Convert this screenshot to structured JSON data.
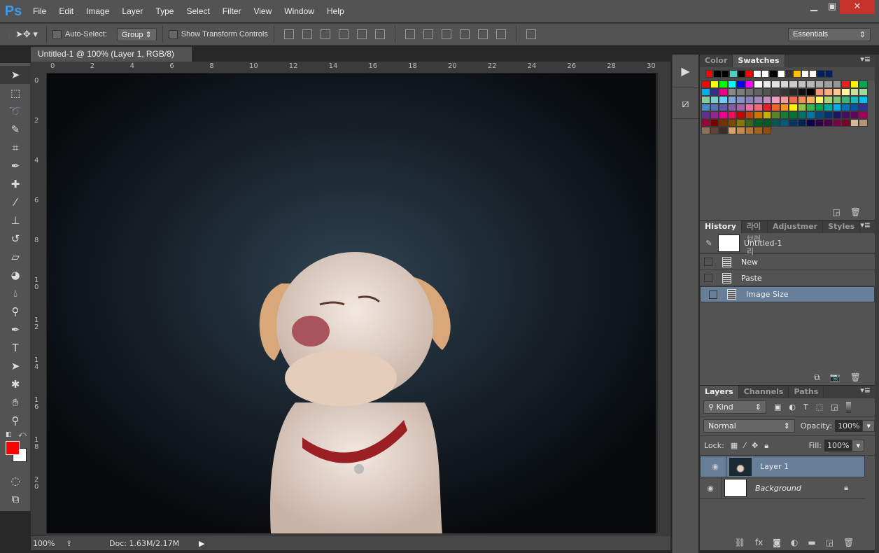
{
  "app": {
    "logo": "Ps",
    "menu": [
      "File",
      "Edit",
      "Image",
      "Layer",
      "Type",
      "Select",
      "Filter",
      "View",
      "Window",
      "Help"
    ],
    "window_controls": [
      "minimize",
      "restore",
      "close"
    ]
  },
  "options": {
    "auto_select_label": "Auto-Select:",
    "auto_select_checked": false,
    "group_value": "Group",
    "show_transform_label": "Show Transform Controls",
    "show_transform_checked": false,
    "workspace": "Essentials"
  },
  "document": {
    "tab_title": "Untitled-1 @ 100% (Layer 1, RGB/8) *",
    "close": "×"
  },
  "rulers": {
    "top": [
      "0",
      "2",
      "4",
      "6",
      "8",
      "10",
      "12",
      "14",
      "16",
      "18",
      "20",
      "22",
      "24",
      "26",
      "28",
      "30"
    ],
    "left": [
      "0",
      "2",
      "4",
      "6",
      "8",
      "10",
      "12",
      "14",
      "16",
      "18",
      "20"
    ]
  },
  "tools": [
    "move-tool",
    "marquee-tool",
    "lasso-tool",
    "quick-selection-tool",
    "crop-tool",
    "eyedropper-tool",
    "healing-brush-tool",
    "brush-tool",
    "clone-stamp-tool",
    "history-brush-tool",
    "eraser-tool",
    "paint-bucket-tool",
    "blur-tool",
    "dodge-tool",
    "pen-tool",
    "type-tool",
    "path-selection-tool",
    "shape-tool",
    "hand-tool",
    "zoom-tool"
  ],
  "colors": {
    "foreground": "#ff0000",
    "background": "#ffffff",
    "selection": "#677f99",
    "canvas_bg": "#1c2a33"
  },
  "status": {
    "zoom": "100%",
    "doc": "Doc: 1.63M/2.17M"
  },
  "swatches": {
    "tabs": [
      "Color",
      "Swatches"
    ],
    "active": "Swatches",
    "recent": [
      "#ff0000",
      "#000000",
      "#000000",
      "#4ecdc4",
      "#000000",
      "#ff0000",
      "#ffffff",
      "#ffffff",
      "#000000",
      "#ffffff",
      "#333333",
      "#ffc000",
      "#fff5f5",
      "#fff8f0",
      "#002060",
      "#002060"
    ],
    "grid": [
      [
        "#ff0000",
        "#ffff00",
        "#00ff00",
        "#00ffff",
        "#0000ff",
        "#ff00ff",
        "#ffffff",
        "#ebebeb",
        "#e1e1e1",
        "#d7d7d7",
        "#cccccc",
        "#c2c2c2",
        "#b7b7b7",
        "#acacac",
        "#a0a0a0",
        "#959595",
        "#ee1d24",
        "#fff100",
        "#00a650"
      ],
      [
        "#00aeef",
        "#2f3192",
        "#ed008c",
        "#898989",
        "#7d7d7d",
        "#707070",
        "#626262",
        "#555555",
        "#464646",
        "#363636",
        "#262626",
        "#111111",
        "#000000",
        "#f7977a",
        "#fbad82",
        "#fdc68c",
        "#fff799",
        "#c6df9c",
        "#a4d49d"
      ],
      [
        "#81ca9d",
        "#7bcdc9",
        "#6ccff7",
        "#7ea6e0",
        "#8493ca",
        "#8882be",
        "#a287bd",
        "#c78dc0",
        "#f49ac1",
        "#f5989d",
        "#f16c4d",
        "#f68e54",
        "#fbaf5a",
        "#fff467",
        "#acd372",
        "#7dc473",
        "#39b778",
        "#16bcb4",
        "#00bff3"
      ],
      [
        "#438ccb",
        "#5573b7",
        "#5e5ca7",
        "#855fa8",
        "#a763a9",
        "#ef6ea8",
        "#f16d7e",
        "#ee1d24",
        "#f16522",
        "#f7941d",
        "#fff100",
        "#8fc63d",
        "#37b44a",
        "#00a650",
        "#00a99e",
        "#00aeef",
        "#0072bc",
        "#0054a5",
        "#2f3192"
      ],
      [
        "#652c91",
        "#91278f",
        "#ed008c",
        "#ee105a",
        "#c80000",
        "#c1440e",
        "#c87800",
        "#c4b000",
        "#598527",
        "#197b30",
        "#007236",
        "#00746b",
        "#0076a4",
        "#004a80",
        "#003370",
        "#1d1363",
        "#450e61",
        "#62055f",
        "#9e005c"
      ],
      [
        "#9d0039",
        "#790000",
        "#7b2e00",
        "#7d4900",
        "#827b00",
        "#3e6617",
        "#045f20",
        "#005824",
        "#005951",
        "#005b7e",
        "#003562",
        "#002056",
        "#0c004b",
        "#30004a",
        "#4b0048",
        "#7a0045",
        "#7a0026",
        "#d7b899",
        "#b39479"
      ],
      [
        "#8c7058",
        "#5e4533",
        "#3b2e28",
        "#d8a46a",
        "#c88d4c",
        "#b57733",
        "#a0621e",
        "#8f4e0e"
      ]
    ]
  },
  "history": {
    "tabs": [
      "History",
      "라이브러리",
      "Adjustmer",
      "Styles"
    ],
    "active": "History",
    "snapshot": "Untitled-1",
    "items": [
      {
        "label": "New",
        "selected": false
      },
      {
        "label": "Paste",
        "selected": false
      },
      {
        "label": "Image Size",
        "selected": true
      }
    ]
  },
  "layers": {
    "tabs": [
      "Layers",
      "Channels",
      "Paths"
    ],
    "active": "Layers",
    "filter": "Kind",
    "blend_mode": "Normal",
    "opacity_label": "Opacity:",
    "opacity": "100%",
    "lock_label": "Lock:",
    "fill_label": "Fill:",
    "fill": "100%",
    "items": [
      {
        "name": "Layer 1",
        "visible": true,
        "selected": true,
        "locked": false
      },
      {
        "name": "Background",
        "visible": true,
        "selected": false,
        "locked": true
      }
    ]
  }
}
